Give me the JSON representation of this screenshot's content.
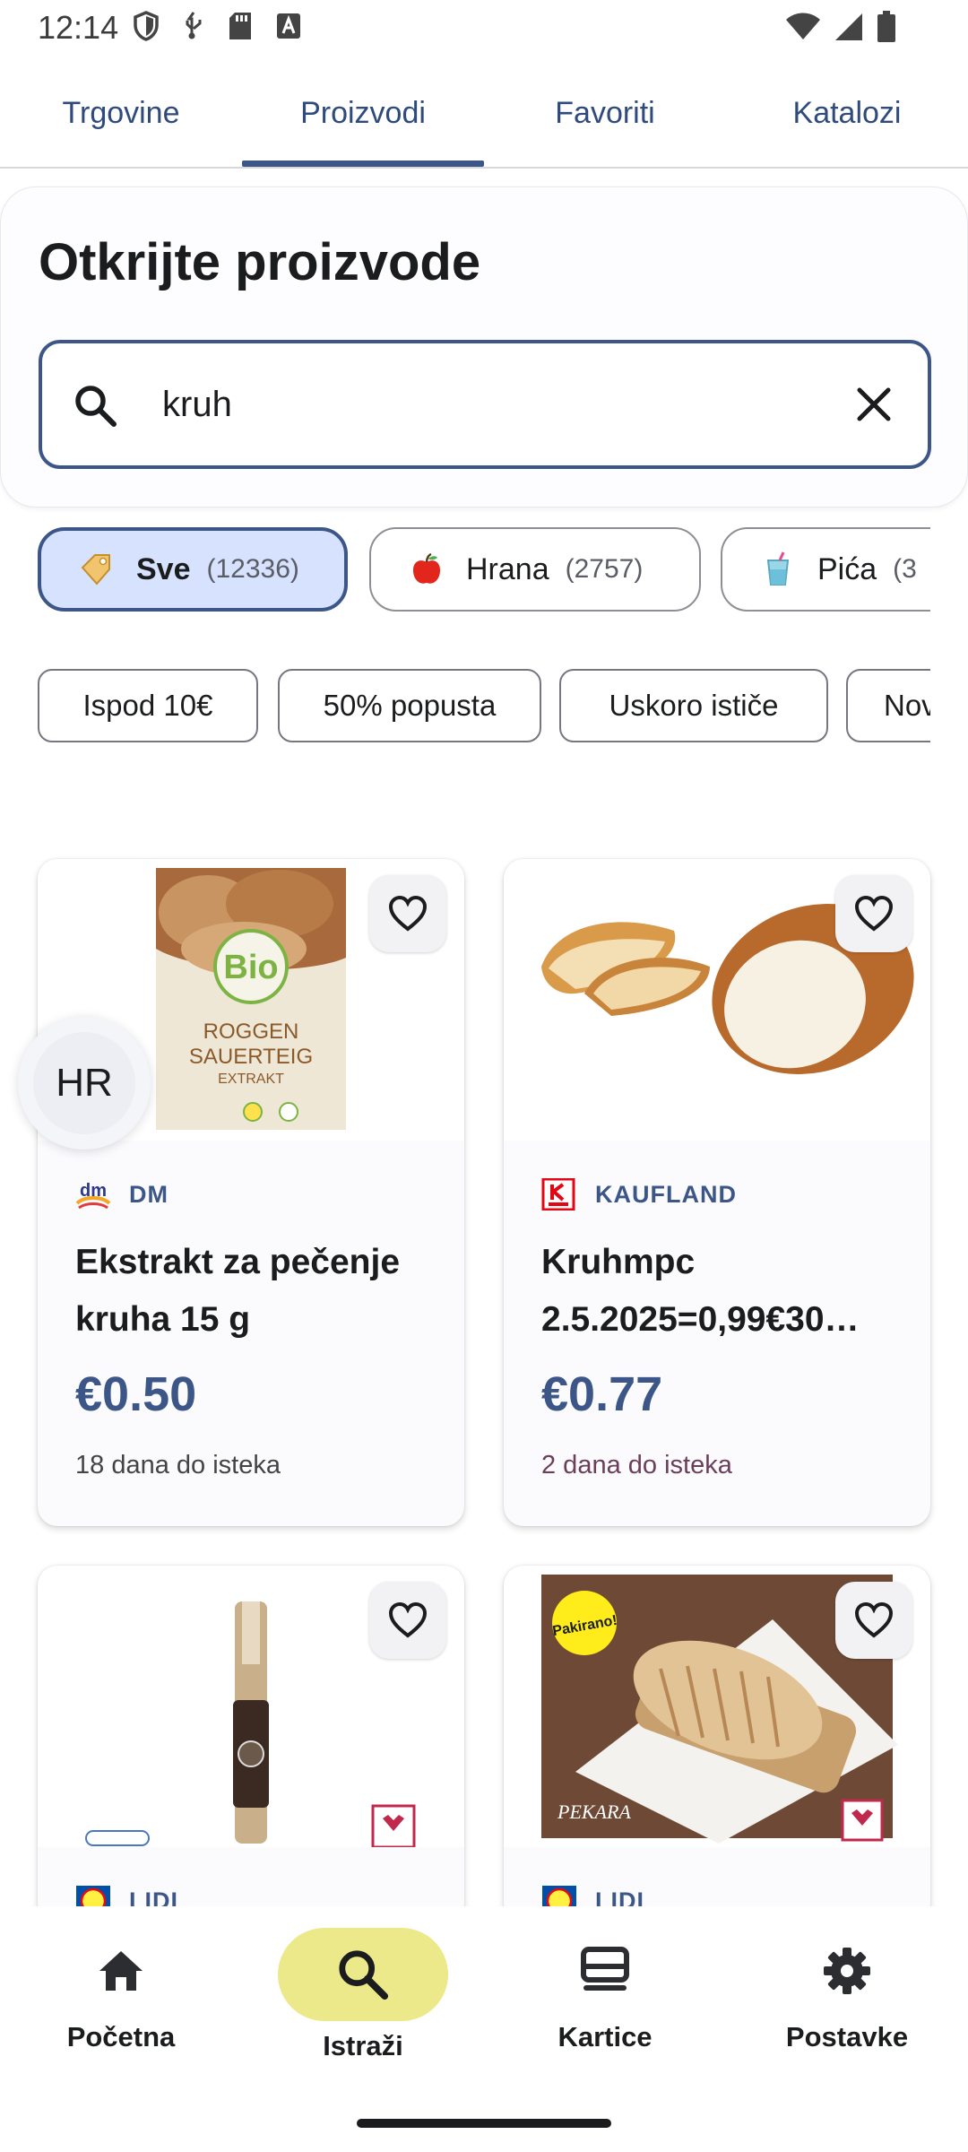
{
  "status_bar": {
    "time": "12:14",
    "left_icons": [
      "shield-icon",
      "usb-icon",
      "sd-card-icon",
      "font-icon"
    ],
    "right_icons": [
      "wifi-icon",
      "signal-icon",
      "battery-icon"
    ]
  },
  "tabs": [
    {
      "label": "Trgovine",
      "selected": false
    },
    {
      "label": "Proizvodi",
      "selected": true
    },
    {
      "label": "Favoriti",
      "selected": false
    },
    {
      "label": "Katalozi",
      "selected": false
    }
  ],
  "header": {
    "title": "Otkrijte proizvode",
    "search": {
      "value": "kruh",
      "placeholder": ""
    }
  },
  "categories": [
    {
      "icon": "tag-icon",
      "label": "Sve",
      "count": "(12336)",
      "selected": true
    },
    {
      "icon": "apple-icon",
      "label": "Hrana",
      "count": "(2757)",
      "selected": false
    },
    {
      "icon": "cup-icon",
      "label": "Pića",
      "count": "(3",
      "selected": false
    }
  ],
  "filters": [
    "Ispod 10€",
    "50% popusta",
    "Uskoro ističe",
    "Nov"
  ],
  "products": [
    {
      "store": "DM",
      "name_line1": "Ekstrakt za pečenje",
      "name_line2": "kruha 15 g",
      "price": "€0.50",
      "expiry": "18 dana do isteka"
    },
    {
      "store": "KAUFLAND",
      "name_line1": "Kruhmpc",
      "name_line2": "2.5.2025=0,99€30…",
      "price": "€0.77",
      "expiry": "2 dana do isteka"
    },
    {
      "store": "LIDL"
    },
    {
      "store": "LIDL",
      "badge": "Pakirano!"
    }
  ],
  "language_bubble": "HR",
  "bottom_nav": [
    {
      "icon": "home-icon",
      "label": "Početna",
      "selected": false
    },
    {
      "icon": "search-icon",
      "label": "Istraži",
      "selected": true
    },
    {
      "icon": "cards-icon",
      "label": "Kartice",
      "selected": false
    },
    {
      "icon": "gear-icon",
      "label": "Postavke",
      "selected": false
    }
  ],
  "colors": {
    "accent": "#3c5688",
    "selected_chip_bg": "#d7e2ff",
    "nav_pill": "#ebe98a"
  }
}
